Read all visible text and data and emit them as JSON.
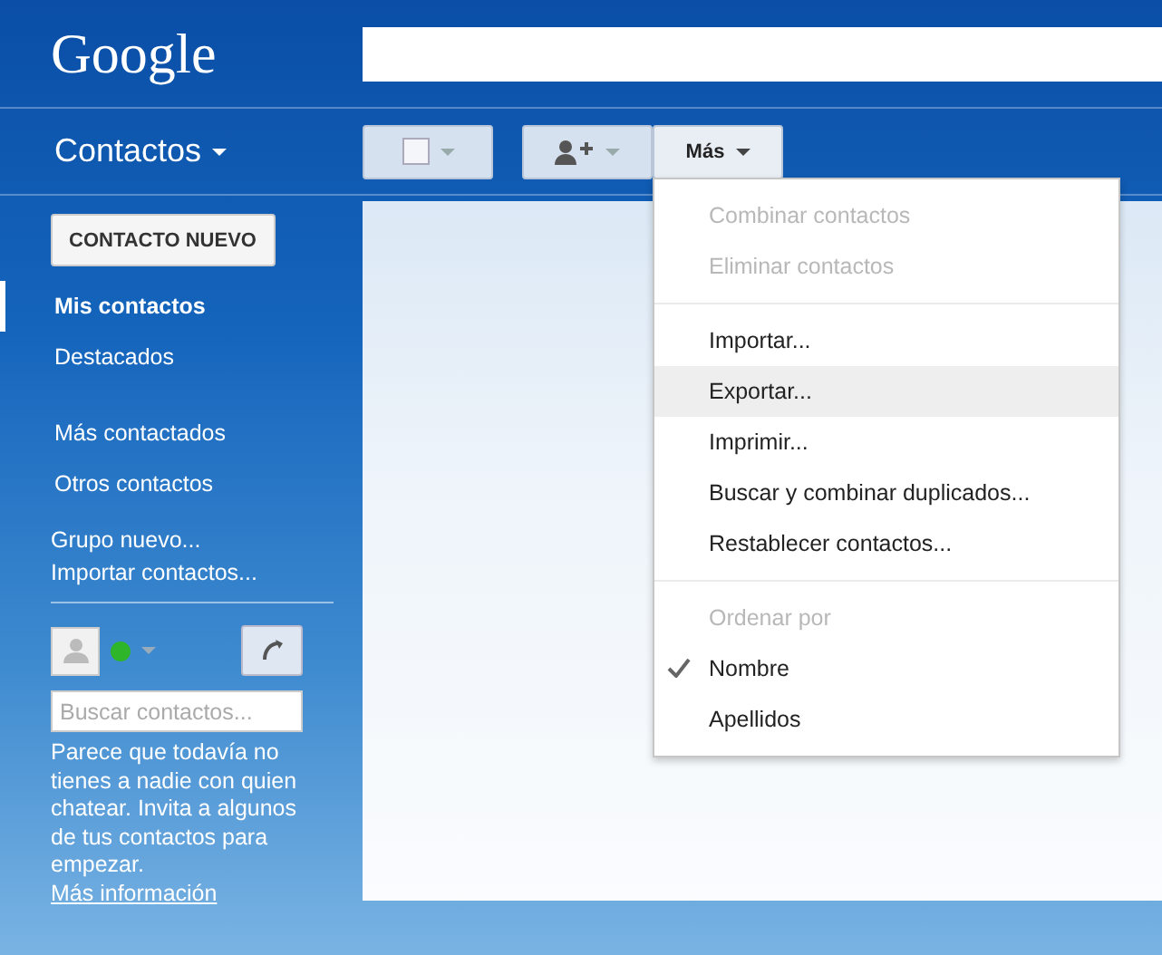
{
  "header": {
    "logo": "Google"
  },
  "app_title": "Contactos",
  "toolbar": {
    "select_checkbox": {
      "checked": false
    },
    "more_button": "Más"
  },
  "sidebar": {
    "new_contact_button": "CONTACTO NUEVO",
    "nav_groups": [
      [
        {
          "label": "Mis contactos",
          "selected": true
        },
        {
          "label": "Destacados",
          "selected": false
        }
      ],
      [
        {
          "label": "Más contactados",
          "selected": false
        },
        {
          "label": "Otros contactos",
          "selected": false
        }
      ]
    ],
    "links": [
      "Grupo nuevo...",
      "Importar contactos..."
    ],
    "chat": {
      "online": true,
      "search": {
        "placeholder": "Buscar contactos..."
      },
      "message": "Parece que todavía no tienes a nadie con quien chatear. Invita a algunos de tus contactos para empezar.",
      "link": "Más información"
    }
  },
  "menu": {
    "sections": [
      {
        "items": [
          {
            "kind": "action",
            "label": "Combinar contactos",
            "disabled": true,
            "highlighted": false
          },
          {
            "kind": "action",
            "label": "Eliminar contactos",
            "disabled": true,
            "highlighted": false
          }
        ]
      },
      {
        "items": [
          {
            "kind": "action",
            "label": "Importar...",
            "disabled": false,
            "highlighted": false
          },
          {
            "kind": "action",
            "label": "Exportar...",
            "disabled": false,
            "highlighted": true
          },
          {
            "kind": "action",
            "label": "Imprimir...",
            "disabled": false,
            "highlighted": false
          },
          {
            "kind": "action",
            "label": "Buscar y combinar duplicados...",
            "disabled": false,
            "highlighted": false
          },
          {
            "kind": "action",
            "label": "Restablecer contactos...",
            "disabled": false,
            "highlighted": false
          }
        ]
      },
      {
        "items": [
          {
            "kind": "heading",
            "label": "Ordenar por"
          },
          {
            "kind": "option",
            "label": "Nombre",
            "checked": true
          },
          {
            "kind": "option",
            "label": "Apellidos",
            "checked": false
          }
        ]
      }
    ]
  }
}
